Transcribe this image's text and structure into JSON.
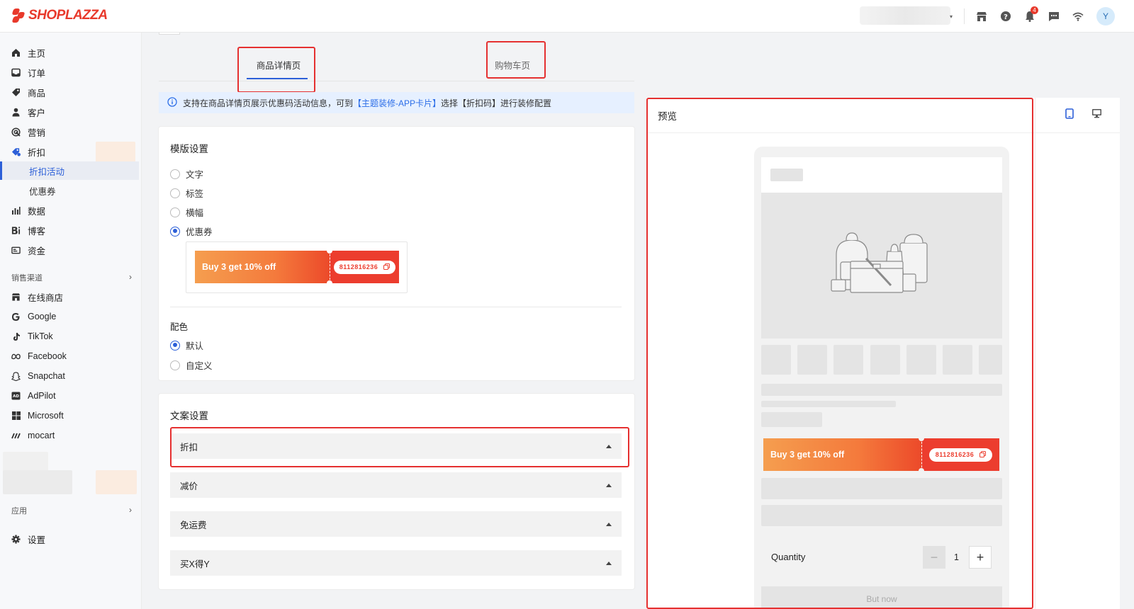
{
  "brand": {
    "name": "SHOPLAZZA",
    "color": "#e8392b"
  },
  "topbar": {
    "notifications_count": "4",
    "avatar_letter": "Y",
    "icons": [
      "store-icon",
      "help-icon",
      "bell-icon",
      "chat-icon",
      "wifi-icon"
    ]
  },
  "sidebar": {
    "items": [
      {
        "label": "主页",
        "icon": "home-icon"
      },
      {
        "label": "订单",
        "icon": "inbox-icon"
      },
      {
        "label": "商品",
        "icon": "tag-icon"
      },
      {
        "label": "客户",
        "icon": "user-icon"
      },
      {
        "label": "营销",
        "icon": "target-icon"
      },
      {
        "label": "折扣",
        "icon": "discount-icon"
      }
    ],
    "subitems": [
      {
        "label": "折扣活动",
        "active": true
      },
      {
        "label": "优惠券",
        "active": false
      }
    ],
    "items2": [
      {
        "label": "数据",
        "icon": "bar-chart-icon"
      },
      {
        "label": "博客",
        "icon": "blog-icon"
      },
      {
        "label": "资金",
        "icon": "wallet-icon"
      }
    ],
    "channels_title": "销售渠道",
    "channels": [
      {
        "label": "在线商店",
        "icon": "store-icon"
      },
      {
        "label": "Google",
        "icon": "google-icon"
      },
      {
        "label": "TikTok",
        "icon": "tiktok-icon"
      },
      {
        "label": "Facebook",
        "icon": "facebook-icon"
      },
      {
        "label": "Snapchat",
        "icon": "snapchat-icon"
      },
      {
        "label": "AdPilot",
        "icon": "adpilot-icon"
      },
      {
        "label": "Microsoft",
        "icon": "microsoft-icon"
      },
      {
        "label": "mocart",
        "icon": "mocart-icon"
      }
    ],
    "apps_title": "应用",
    "settings_label": "设置"
  },
  "tabs": [
    {
      "label": "商品详情页",
      "active": true
    },
    {
      "label": "购物车页",
      "active": false
    }
  ],
  "info": {
    "prefix": "支持在商品详情页展示优惠码活动信息，可到",
    "link": "【主题装修-APP卡片】",
    "suffix": "选择【折扣码】进行装修配置"
  },
  "template_settings": {
    "title": "模版设置",
    "options": [
      {
        "label": "文字",
        "checked": false
      },
      {
        "label": "标签",
        "checked": false
      },
      {
        "label": "横幅",
        "checked": false
      },
      {
        "label": "优惠券",
        "checked": true
      }
    ]
  },
  "coupon": {
    "text": "Buy 3 get 10% off",
    "code": "8112816236"
  },
  "color_settings": {
    "title": "配色",
    "options": [
      {
        "label": "默认",
        "checked": true
      },
      {
        "label": "自定义",
        "checked": false
      }
    ]
  },
  "copy_settings": {
    "title": "文案设置",
    "items": [
      "折扣",
      "减价",
      "免运费",
      "买X得Y"
    ]
  },
  "preview": {
    "title": "预览",
    "quantity_label": "Quantity",
    "quantity_value": "1",
    "buy_label": "But now"
  }
}
